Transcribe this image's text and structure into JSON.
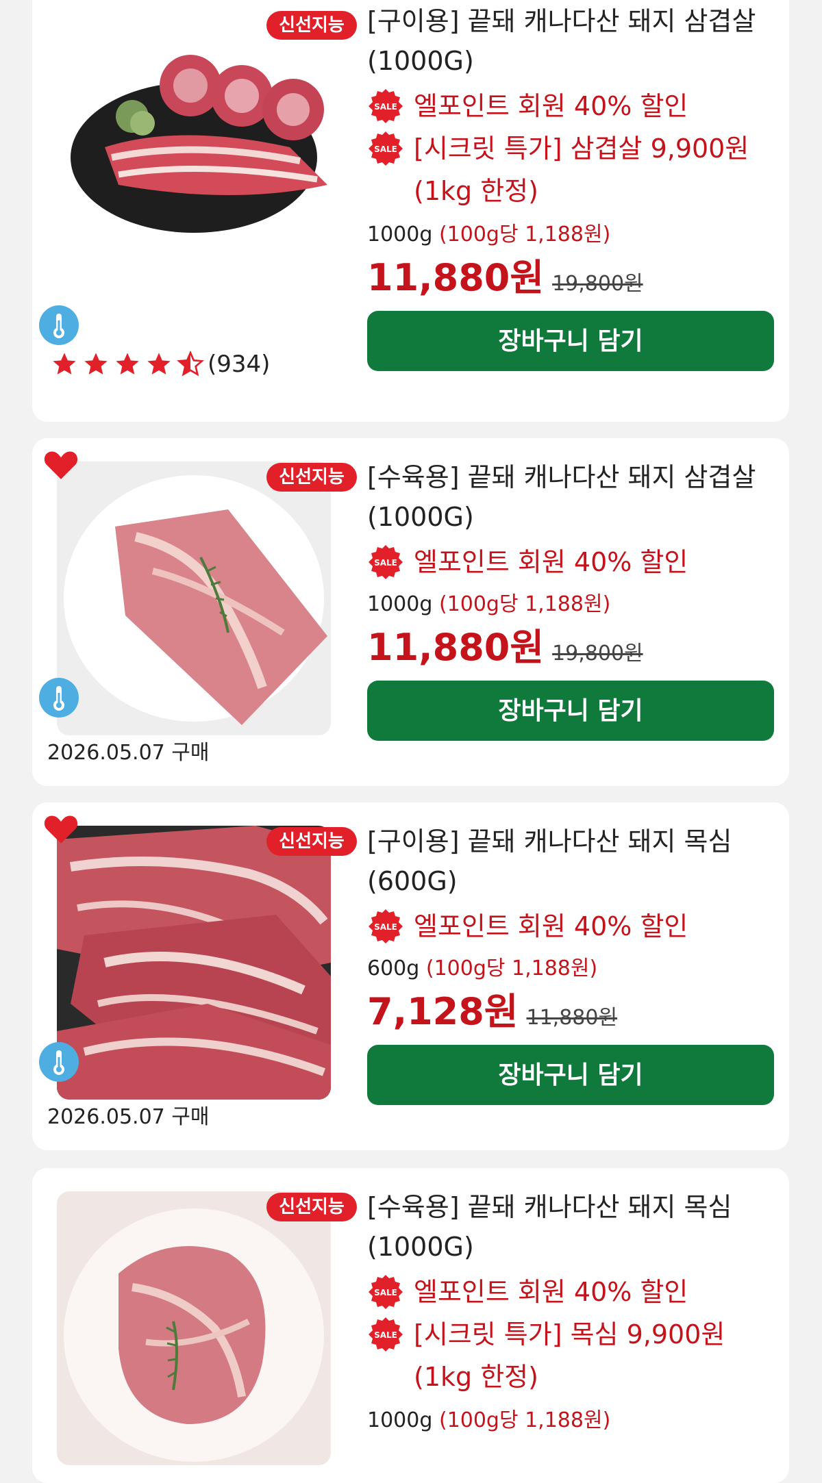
{
  "products": [
    {
      "badge": "신선지능",
      "title": "[구이용] 끝돼 캐나다산 돼지 삼겹살 (1000G)",
      "promos": [
        "엘포인트 회원 40% 할인",
        "[시크릿 특가] 삼겹살 9,900원 (1kg 한정)"
      ],
      "weight": "1000g",
      "unit_price": "(100g당 1,188원)",
      "price": "11,880원",
      "original_price": "19,800원",
      "cart_label": "장바구니 담기",
      "rating": 4.5,
      "review_count": "(934)"
    },
    {
      "badge": "신선지능",
      "title": "[수육용] 끝돼 캐나다산 돼지 삼겹살 (1000G)",
      "promos": [
        "엘포인트 회원 40% 할인"
      ],
      "weight": "1000g",
      "unit_price": "(100g당 1,188원)",
      "price": "11,880원",
      "original_price": "19,800원",
      "cart_label": "장바구니 담기",
      "purchase_date": "2026.05.07 구매"
    },
    {
      "badge": "신선지능",
      "title": "[구이용] 끝돼 캐나다산 돼지 목심 (600G)",
      "promos": [
        "엘포인트 회원 40% 할인"
      ],
      "weight": "600g",
      "unit_price": "(100g당 1,188원)",
      "price": "7,128원",
      "original_price": "11,880원",
      "cart_label": "장바구니 담기",
      "purchase_date": "2026.05.07 구매"
    },
    {
      "badge": "신선지능",
      "title": "[수육용] 끝돼 캐나다산 돼지 목심 (1000G)",
      "promos": [
        "엘포인트 회원 40% 할인",
        "[시크릿 특가] 목심 9,900원 (1kg 한정)"
      ],
      "weight": "1000g",
      "unit_price": "(100g당 1,188원)"
    }
  ],
  "sale_icon_label": "SALE",
  "colors": {
    "accent_red": "#c4131b",
    "badge_red": "#e2202a",
    "cart_green": "#0f7a3c",
    "thermo_blue": "#4eaee2"
  }
}
